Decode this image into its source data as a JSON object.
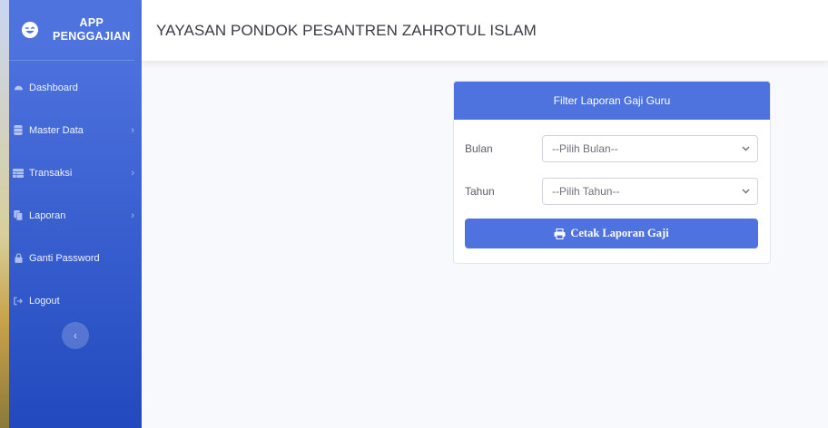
{
  "brand": {
    "line1": "APP",
    "line2": "PENGGAJIAN"
  },
  "sidebar": {
    "items": [
      {
        "label": "Dashboard",
        "icon": "dashboard-icon",
        "has_chevron": false
      },
      {
        "label": "Master Data",
        "icon": "database-icon",
        "has_chevron": true
      },
      {
        "label": "Transaksi",
        "icon": "table-icon",
        "has_chevron": true
      },
      {
        "label": "Laporan",
        "icon": "copy-icon",
        "has_chevron": true
      },
      {
        "label": "Ganti Password",
        "icon": "lock-icon",
        "has_chevron": false
      },
      {
        "label": "Logout",
        "icon": "sign-out-icon",
        "has_chevron": false
      }
    ],
    "chevron": "›",
    "toggle": "‹"
  },
  "header": {
    "title": "YAYASAN PONDOK PESANTREN ZAHROTUL ISLAM"
  },
  "card": {
    "title": "Filter Laporan Gaji Guru",
    "fields": [
      {
        "label": "Bulan",
        "value": "--Pilih Bulan--"
      },
      {
        "label": "Tahun",
        "value": "--Pilih Tahun--"
      }
    ],
    "button": "Cetak Laporan Gaji"
  },
  "colors": {
    "primary": "#4e73df",
    "sidebar_bottom": "#224abe",
    "background": "#f8f9fc"
  }
}
